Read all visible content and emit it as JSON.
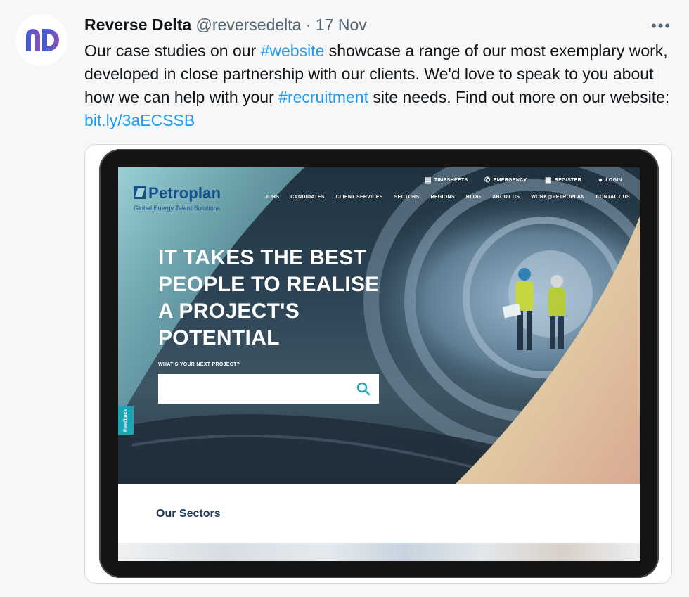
{
  "tweet": {
    "avatar_text": "rD",
    "display_name": "Reverse Delta",
    "handle": "@reversedelta",
    "separator": "·",
    "date": "17 Nov",
    "more_label": "•••",
    "text_1": "Our case studies on our ",
    "hashtag_1": "#website",
    "text_2": " showcase a range of our most exemplary work, developed in close partnership with our clients. We'd love to speak to you about how we can help with your ",
    "hashtag_2": "#recruitment",
    "text_3": " site needs. Find out more on our website: ",
    "link": "bit.ly/3aECSSB"
  },
  "website": {
    "logo_name": "Petroplan",
    "logo_tagline": "Global Energy Talent Solutions",
    "utility_nav": [
      {
        "label": "TIMESHEETS",
        "icon": "document-icon"
      },
      {
        "label": "EMERGENCY",
        "icon": "phone-icon"
      },
      {
        "label": "REGISTER",
        "icon": "file-icon"
      },
      {
        "label": "LOGIN",
        "icon": "user-icon"
      }
    ],
    "main_nav": [
      "JOBS",
      "CANDIDATES",
      "CLIENT SERVICES",
      "SECTORS",
      "REGIONS",
      "BLOG",
      "ABOUT US",
      "WORK@PETROPLAN",
      "CONTACT US"
    ],
    "headline": "IT TAKES THE BEST PEOPLE TO REALISE A PROJECT'S POTENTIAL",
    "search_label": "WHAT'S YOUR NEXT PROJECT?",
    "search_value": "",
    "feedback_label": "Feedback",
    "sectors_heading": "Our Sectors"
  },
  "colors": {
    "link_blue": "#1d9bf0",
    "petroplan_navy": "#134f8c",
    "feedback_teal": "#1aa6b7",
    "avatar_gradient_start": "#3b5fd6",
    "avatar_gradient_end": "#8a4fb8"
  }
}
